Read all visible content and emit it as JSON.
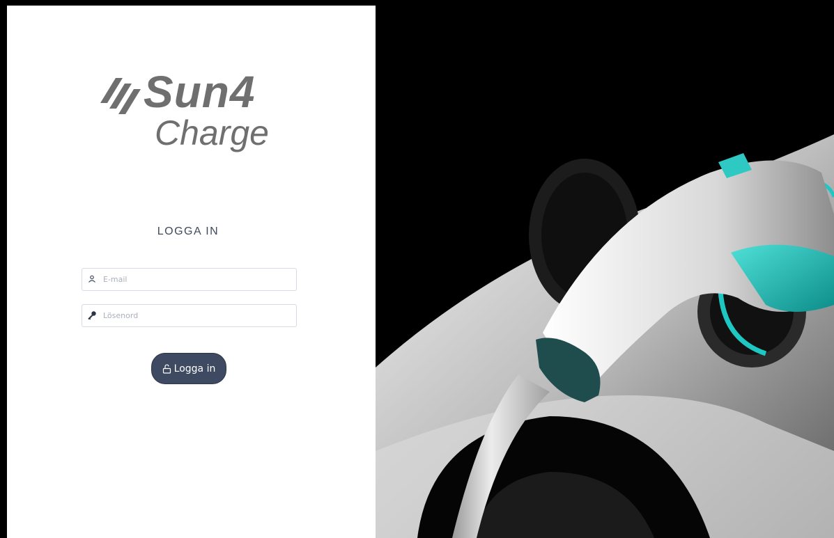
{
  "logo": {
    "line1": "Sun4",
    "line2": "Charge"
  },
  "login": {
    "title": "LOGGA IN",
    "email_placeholder": "E-mail",
    "email_value": "",
    "password_placeholder": "Lösenord",
    "password_value": "",
    "button_label": "Logga in"
  },
  "icons": {
    "email": "user-icon",
    "password": "key-icon",
    "button": "unlock-icon"
  },
  "colors": {
    "button_bg": "#3e4a62",
    "logo": "#6f6f6f",
    "accent_teal": "#1fc7c2"
  }
}
